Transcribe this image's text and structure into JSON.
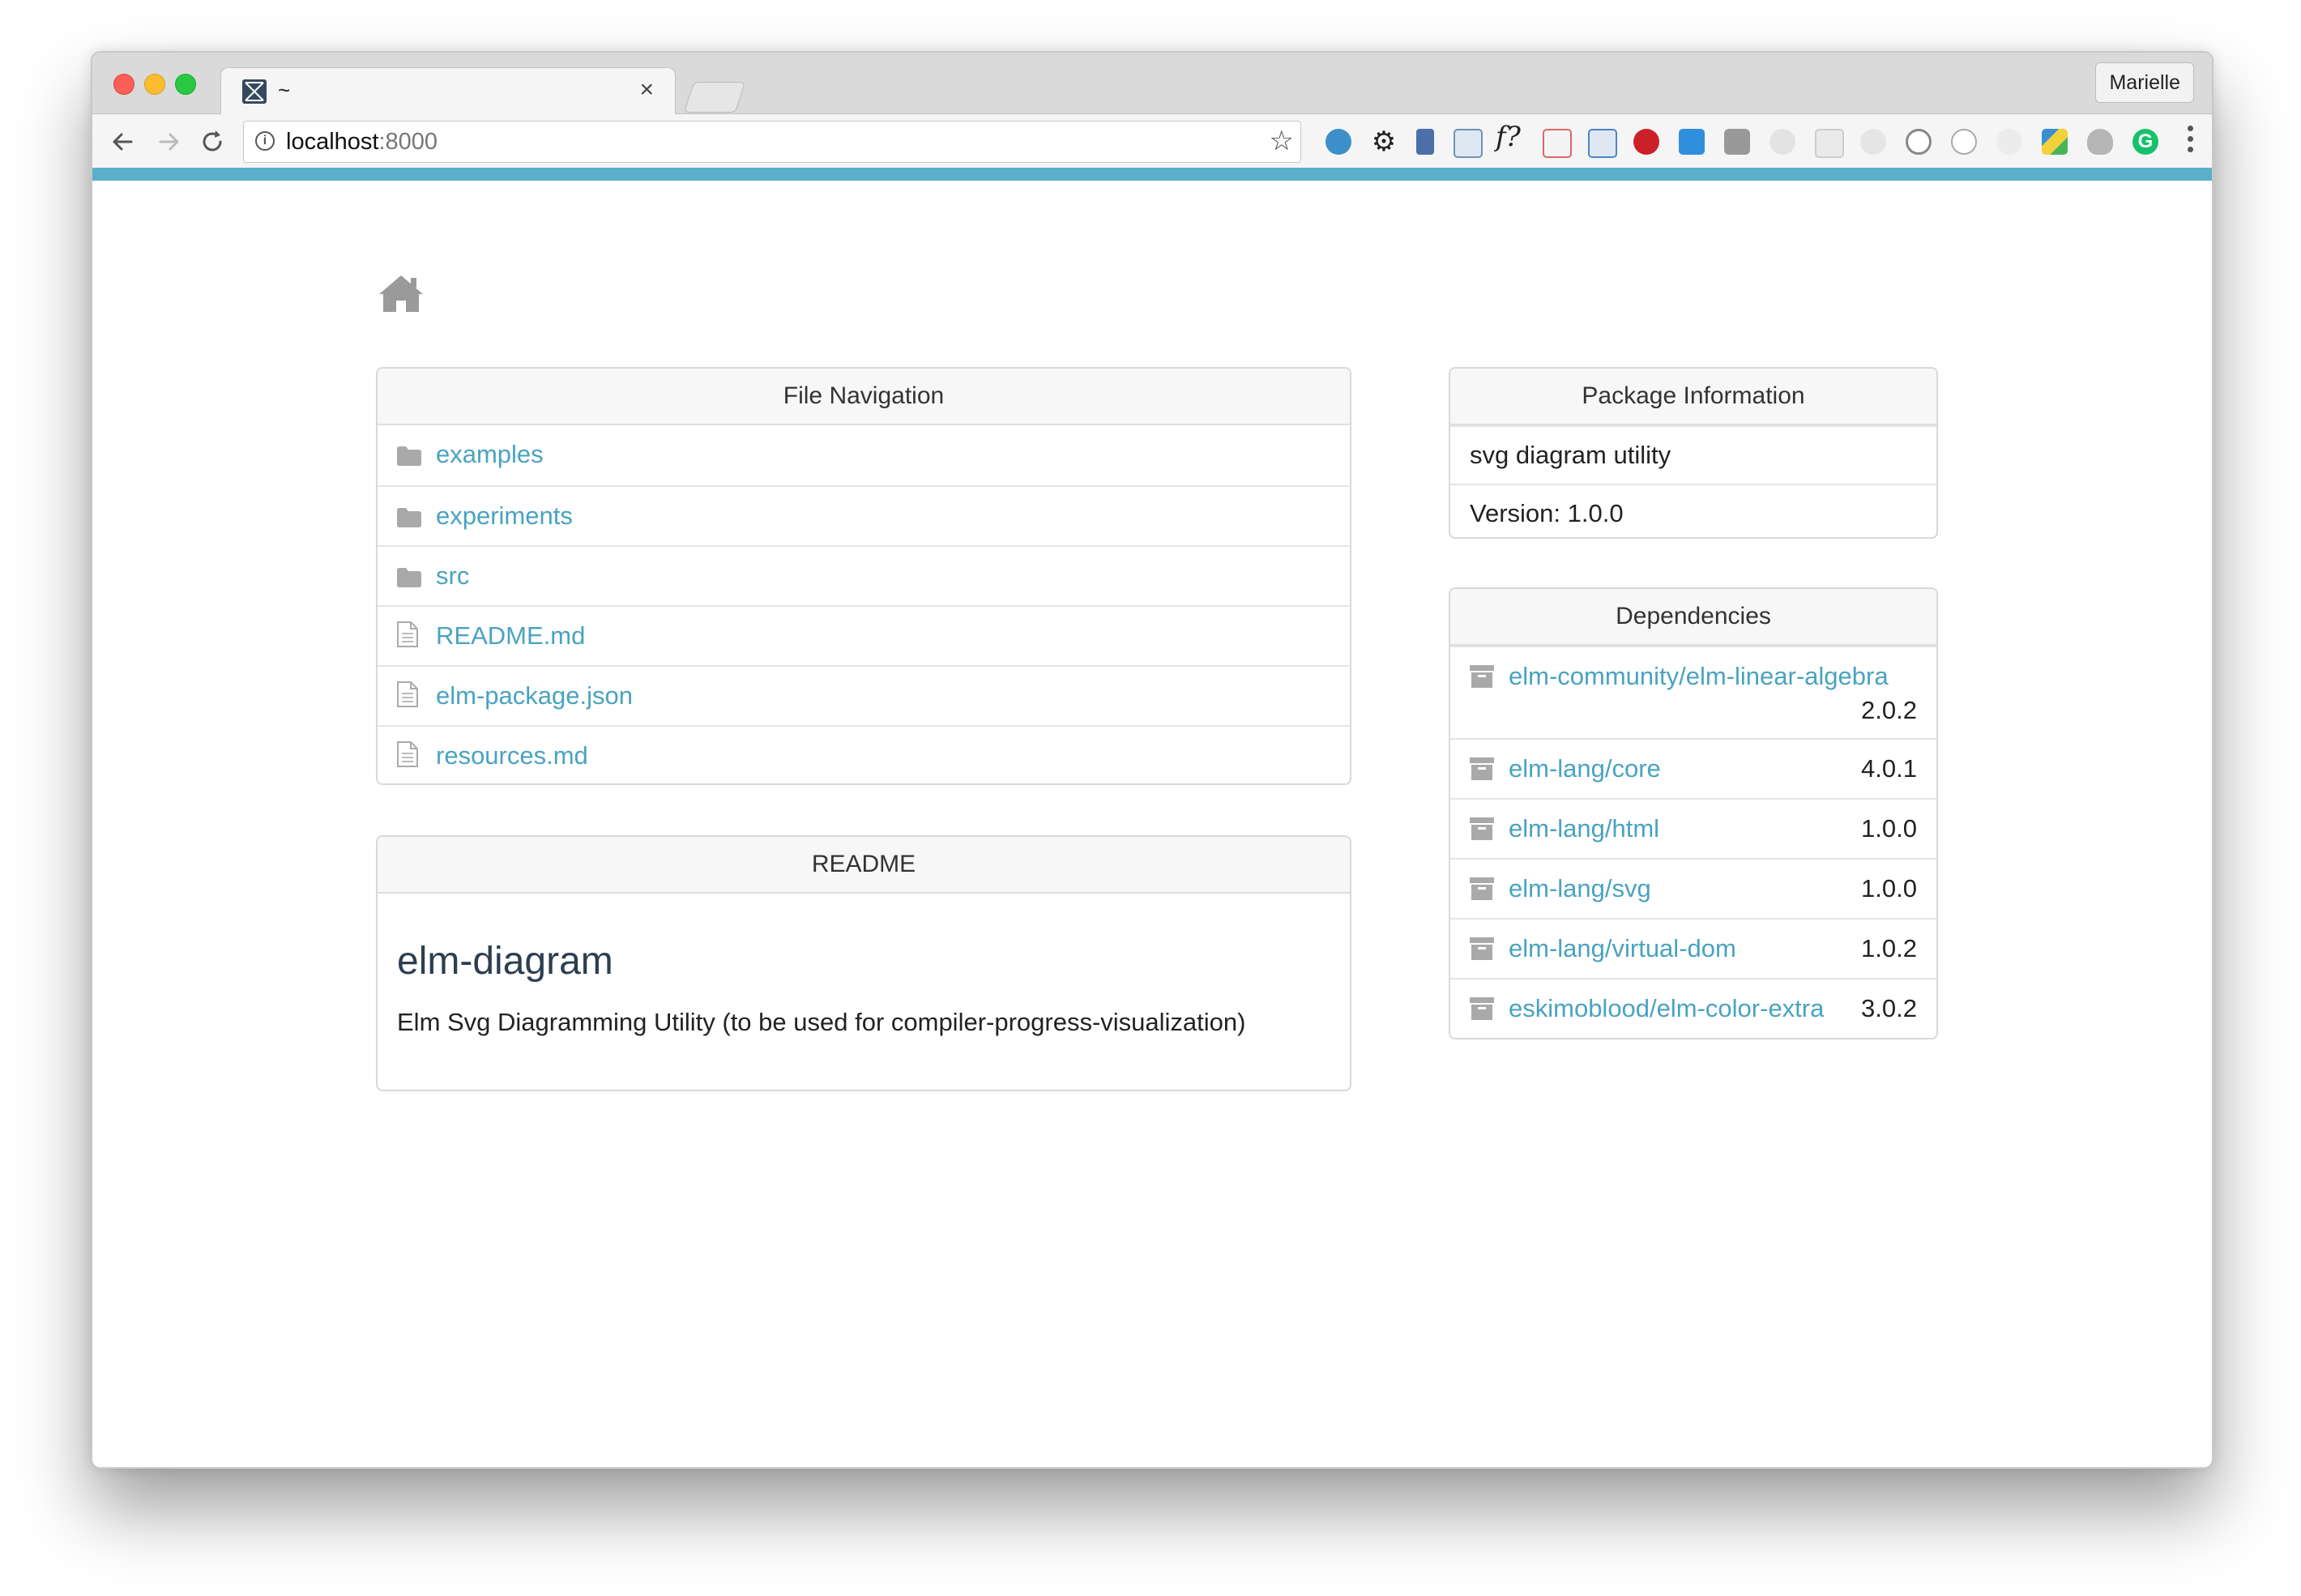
{
  "browser": {
    "tab_title": "~",
    "tab_close": "×",
    "profile_name": "Marielle",
    "url_host": "localhost",
    "url_port": ":8000",
    "extension_label": "f?"
  },
  "file_nav": {
    "heading": "File Navigation",
    "items": [
      {
        "name": "examples",
        "type": "folder"
      },
      {
        "name": "experiments",
        "type": "folder"
      },
      {
        "name": "src",
        "type": "folder"
      },
      {
        "name": "README.md",
        "type": "file"
      },
      {
        "name": "elm-package.json",
        "type": "file"
      },
      {
        "name": "resources.md",
        "type": "file"
      }
    ]
  },
  "readme": {
    "heading": "README",
    "title": "elm-diagram",
    "text": "Elm Svg Diagramming Utility (to be used for compiler-progress-visualization)"
  },
  "package_info": {
    "heading": "Package Information",
    "summary": "svg diagram utility",
    "version": "Version: 1.0.0"
  },
  "dependencies": {
    "heading": "Dependencies",
    "items": [
      {
        "name": "elm-community/elm-linear-algebra",
        "version": "2.0.2"
      },
      {
        "name": "elm-lang/core",
        "version": "4.0.1"
      },
      {
        "name": "elm-lang/html",
        "version": "1.0.0"
      },
      {
        "name": "elm-lang/svg",
        "version": "1.0.0"
      },
      {
        "name": "elm-lang/virtual-dom",
        "version": "1.0.2"
      },
      {
        "name": "eskimoblood/elm-color-extra",
        "version": "3.0.2"
      }
    ]
  },
  "colors": {
    "accent_bar": "#5bafc9",
    "link": "#4aa3c0",
    "heading_text": "#2c3e50"
  }
}
